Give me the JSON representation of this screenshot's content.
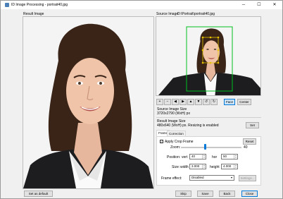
{
  "window": {
    "title": "ID Image Processing - portrait40.jpg",
    "controls": {
      "minimize": "─",
      "maximize": "☐",
      "close": "✕"
    }
  },
  "result_image": {
    "label": "Result Image"
  },
  "source_image": {
    "label": "Source Image:",
    "path": "D:\\Portrait\\portrait40.jpg"
  },
  "toolbar": {
    "buttons": [
      "+",
      "−",
      "◀",
      "▶",
      "▲",
      "▼",
      "↺",
      "↻"
    ],
    "face_label": "Face",
    "center_label": "Center"
  },
  "source_size": {
    "label": "Source Image Size",
    "value": "3720x2790 (WxH) px"
  },
  "result_size": {
    "label": "Result Image Size",
    "value": "480x640 (WxH) px. Resizing is enabled",
    "set_label": "Set"
  },
  "tabs": [
    {
      "label": "Frame"
    },
    {
      "label": "Correction"
    }
  ],
  "frame": {
    "apply_crop_label": "Apply Crop Frame",
    "apply_crop_checked": true,
    "reset_label": "Reset",
    "zoom_label": "Zoom:",
    "zoom_value": "40",
    "position_label": "Position:",
    "vert_label": "vert",
    "vert_value": "40",
    "hor_label": "hor",
    "hor_value": "50",
    "size_label": "Size:",
    "width_label": "width",
    "width_value": "3.000",
    "height_label": "height",
    "height_value": "4.000",
    "effect_label": "Frame effect:",
    "effect_value": "Disabled",
    "settings_label": "Settings..."
  },
  "footer": {
    "set_default_label": "Set as default",
    "skip_label": "Skip",
    "save_label": "Save",
    "back_label": "Back",
    "close_label": "Close"
  }
}
